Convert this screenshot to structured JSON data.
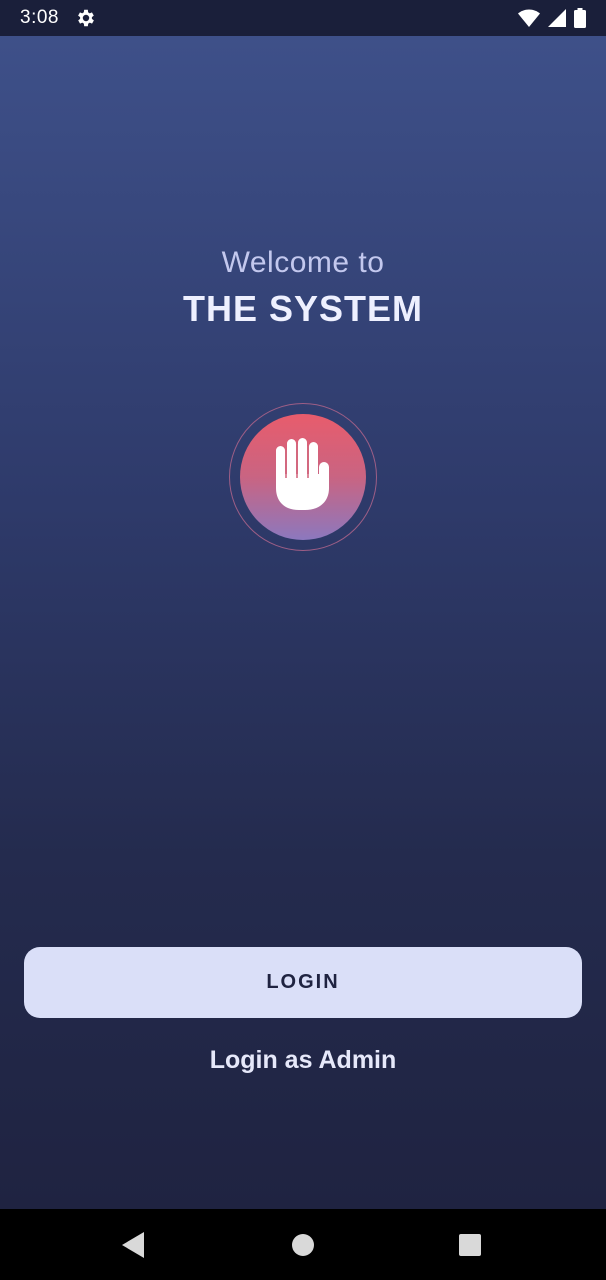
{
  "status_bar": {
    "time": "3:08",
    "left_icons": [
      "gear-icon"
    ],
    "right_icons": [
      "wifi-icon",
      "signal-icon",
      "battery-icon"
    ]
  },
  "welcome": {
    "subtitle": "Welcome to",
    "title": "THE SYSTEM"
  },
  "logo": {
    "icon": "hand-icon",
    "colors": {
      "top": "#e85c6c",
      "bottom": "#8c78be"
    }
  },
  "actions": {
    "login_label": "LOGIN",
    "admin_label": "Login as Admin"
  },
  "nav_bar": {
    "buttons": [
      "back-icon",
      "home-icon",
      "recents-icon"
    ]
  },
  "colors": {
    "background_top": "#3e5089",
    "background_bottom": "#1f2341",
    "button_bg": "#dadff8",
    "button_text": "#1f2341"
  }
}
